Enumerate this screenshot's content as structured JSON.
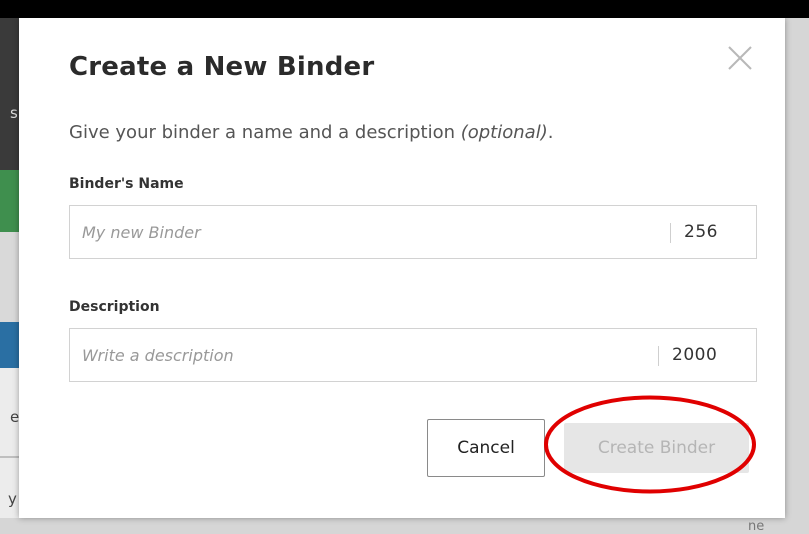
{
  "background": {
    "left_fragments": [
      "s",
      "e",
      "y"
    ],
    "right_fragment": "ne"
  },
  "modal": {
    "title": "Create a New Binder",
    "close_label": "×",
    "subtitle_main": "Give your binder a name and a description ",
    "subtitle_optional": "(optional)",
    "subtitle_end": ".",
    "name_field": {
      "label": "Binder's Name",
      "placeholder": "My new Binder",
      "value": "",
      "char_count": "256"
    },
    "description_field": {
      "label": "Description",
      "placeholder": "Write a description",
      "value": "",
      "char_count": "2000"
    },
    "cancel_label": "Cancel",
    "create_label": "Create Binder"
  },
  "annotation": {
    "color": "#e00000",
    "target": "create-binder-button"
  },
  "colors": {
    "modal_bg": "#ffffff",
    "title_text": "#2b2b2b",
    "disabled_button_bg": "#e6e6e6",
    "disabled_button_text": "#b5b5b5"
  }
}
